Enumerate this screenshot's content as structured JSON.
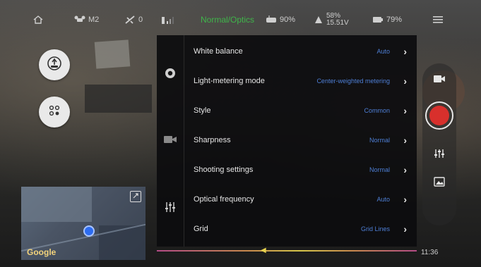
{
  "status_bar": {
    "drone_label": "M2",
    "satellite_count": "0",
    "mode": "Normal/Optics",
    "remote_battery": "90%",
    "aircraft_battery_percent": "58%",
    "aircraft_voltage": "15.51V",
    "camera_battery": "79%",
    "mode_color": "#3fb54a"
  },
  "settings_menu": {
    "rows": [
      {
        "label": "White balance",
        "value": "Auto"
      },
      {
        "label": "Light-metering mode",
        "value": "Center-weighted metering"
      },
      {
        "label": "Style",
        "value": "Common"
      },
      {
        "label": "Sharpness",
        "value": "Normal"
      },
      {
        "label": "Shooting settings",
        "value": "Normal"
      },
      {
        "label": "Optical frequency",
        "value": "Auto"
      },
      {
        "label": "Grid",
        "value": "Grid Lines"
      }
    ],
    "value_color": "#4e7fd6",
    "chevron": "›"
  },
  "side_tabs": [
    "camera-aperture-icon",
    "video-camera-icon",
    "sliders-icon"
  ],
  "map": {
    "logo": "Google"
  },
  "timeline": {
    "time": "11:36"
  },
  "right_controls": {
    "record_color": "#d8302c"
  }
}
